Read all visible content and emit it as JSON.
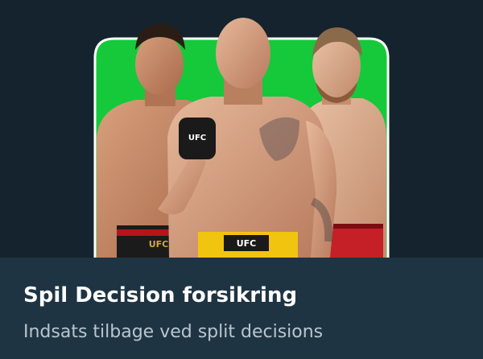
{
  "promo": {
    "title": "Spil Decision forsikring",
    "subtitle": "Indsats tilbage ved split decisions"
  },
  "hero": {
    "logo_text": "UFC",
    "colors": {
      "background": "#14232d",
      "panel": "#15c93b",
      "footer": "#1f3442"
    }
  }
}
